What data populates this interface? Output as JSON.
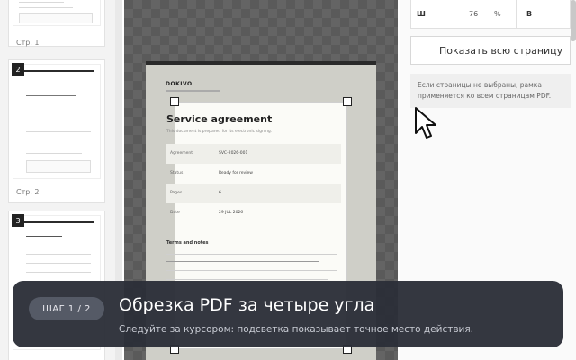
{
  "thumbnails": [
    {
      "number": "",
      "label": "Стр. 1",
      "title": "",
      "brand": ""
    },
    {
      "number": "2",
      "label": "Стр. 2",
      "title": "Agreement appendix 1",
      "brand": "DOKIVO"
    },
    {
      "number": "3",
      "label": "",
      "title": "Agreement appendix 2",
      "brand": "DOKIVO"
    }
  ],
  "document": {
    "brand": "DOKIVO",
    "title": "Service agreement",
    "subtitle": "This document is prepared for its electronic signing.",
    "rows": [
      {
        "key": "Agreement",
        "value": "SVC-2026-001"
      },
      {
        "key": "Status",
        "value": "Ready for review"
      },
      {
        "key": "Pages",
        "value": "6"
      },
      {
        "key": "Date",
        "value": "29 JUL 2026"
      }
    ],
    "terms_heading": "Terms and notes"
  },
  "right_panel": {
    "width_label": "Ш",
    "width_value": "76",
    "width_unit": "%",
    "height_label": "В",
    "show_all_button": "Показать всю страницу",
    "hint": "Если страницы не выбраны, рамка применяется ко всем страницам PDF."
  },
  "banner": {
    "step": "ШАГ 1 / 2",
    "title": "Обрезка PDF за четыре угла",
    "subtitle": "Следуйте за курсором: подсветка показывает точное место действия."
  }
}
